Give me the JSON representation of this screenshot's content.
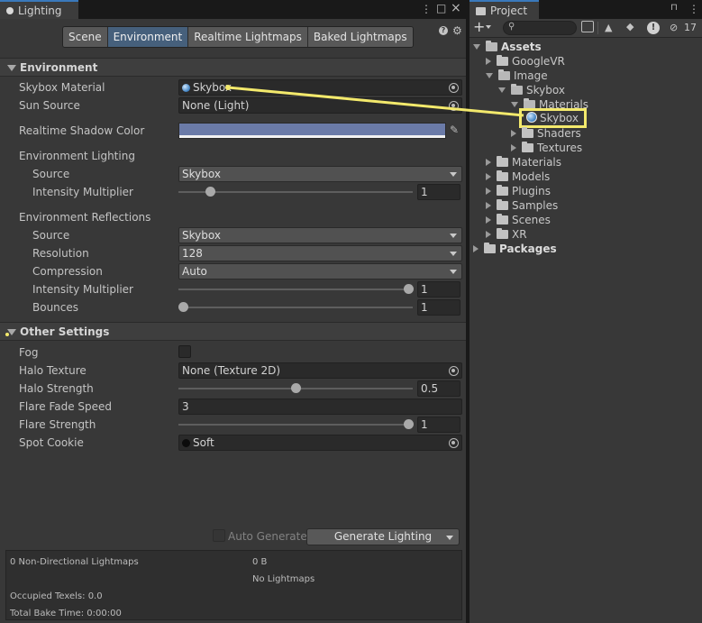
{
  "lighting": {
    "tab_title": "Lighting",
    "window_icons": {
      "menu": "⋮",
      "maximize": "□",
      "close": "×"
    },
    "modes": [
      "Scene",
      "Environment",
      "Realtime Lightmaps",
      "Baked Lightmaps"
    ],
    "active_mode": "Environment",
    "environment": {
      "header": "Environment",
      "skybox_material": {
        "label": "Skybox Material",
        "value": "Skybox"
      },
      "sun_source": {
        "label": "Sun Source",
        "value": "None (Light)"
      },
      "realtime_shadow_color": {
        "label": "Realtime Shadow Color",
        "color": "#6b7ba8"
      },
      "lighting_header": "Environment Lighting",
      "lighting_source": {
        "label": "Source",
        "value": "Skybox"
      },
      "lighting_intensity": {
        "label": "Intensity Multiplier",
        "value": "1",
        "fraction": 0.1
      },
      "reflections_header": "Environment Reflections",
      "reflection_source": {
        "label": "Source",
        "value": "Skybox"
      },
      "resolution": {
        "label": "Resolution",
        "value": "128"
      },
      "compression": {
        "label": "Compression",
        "value": "Auto"
      },
      "reflection_intensity": {
        "label": "Intensity Multiplier",
        "value": "1",
        "fraction": 1.0
      },
      "bounces": {
        "label": "Bounces",
        "value": "1",
        "fraction": 0.0
      }
    },
    "other_settings": {
      "header": "Other Settings",
      "fog": {
        "label": "Fog",
        "checked": false
      },
      "halo_texture": {
        "label": "Halo Texture",
        "value": "None (Texture 2D)"
      },
      "halo_strength": {
        "label": "Halo Strength",
        "value": "0.5",
        "fraction": 0.5
      },
      "flare_fade_speed": {
        "label": "Flare Fade Speed",
        "value": "3"
      },
      "flare_strength": {
        "label": "Flare Strength",
        "value": "1",
        "fraction": 1.0
      },
      "spot_cookie": {
        "label": "Spot Cookie",
        "value": "Soft"
      }
    },
    "auto_generate_label": "Auto Generate",
    "generate_lighting_label": "Generate Lighting",
    "stats": {
      "lightmaps": "0 Non-Directional Lightmaps",
      "size": "0 B",
      "no_lightmaps": "No Lightmaps",
      "occupied_texels": "Occupied Texels: 0.0",
      "total_bake_time": "Total Bake Time: 0:00:00"
    }
  },
  "project": {
    "tab_title": "Project",
    "window_icons": {
      "lock": "🔒",
      "menu": "⋮"
    },
    "toolbar": {
      "add": "+",
      "search_placeholder": "",
      "hidden_count": "17"
    },
    "tree": [
      {
        "label": "Assets",
        "depth": 0,
        "state": "open",
        "bold": true
      },
      {
        "label": "GoogleVR",
        "depth": 1,
        "state": "closed"
      },
      {
        "label": "Image",
        "depth": 1,
        "state": "open"
      },
      {
        "label": "Skybox",
        "depth": 2,
        "state": "open"
      },
      {
        "label": "Materials",
        "depth": 3,
        "state": "open"
      },
      {
        "label": "Skybox",
        "depth": 4,
        "state": "asset",
        "highlighted": true
      },
      {
        "label": "Shaders",
        "depth": 3,
        "state": "closed"
      },
      {
        "label": "Textures",
        "depth": 3,
        "state": "closed"
      },
      {
        "label": "Materials",
        "depth": 1,
        "state": "closed"
      },
      {
        "label": "Models",
        "depth": 1,
        "state": "closed"
      },
      {
        "label": "Plugins",
        "depth": 1,
        "state": "closed"
      },
      {
        "label": "Samples",
        "depth": 1,
        "state": "closed"
      },
      {
        "label": "Scenes",
        "depth": 1,
        "state": "closed"
      },
      {
        "label": "XR",
        "depth": 1,
        "state": "closed"
      },
      {
        "label": "Packages",
        "depth": 0,
        "state": "closed",
        "bold": true
      }
    ]
  },
  "annotation": {
    "color": "#f3e96c"
  }
}
